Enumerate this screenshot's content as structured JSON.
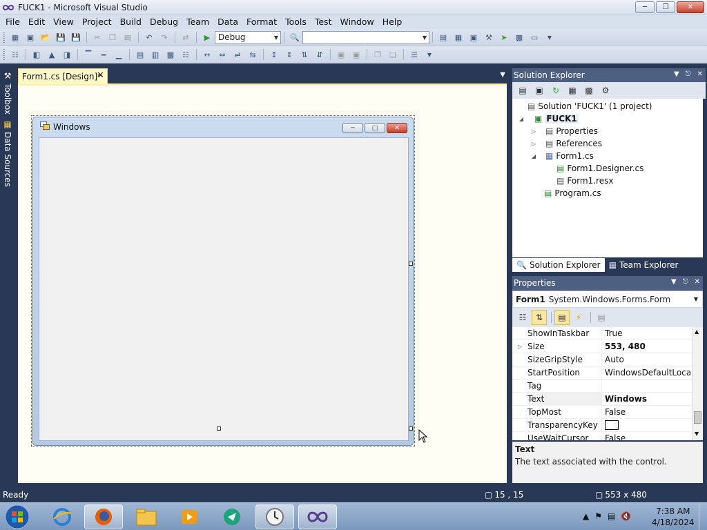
{
  "window": {
    "title": "FUCK1 - Microsoft Visual Studio"
  },
  "menu": [
    "File",
    "Edit",
    "View",
    "Project",
    "Build",
    "Debug",
    "Team",
    "Data",
    "Format",
    "Tools",
    "Test",
    "Window",
    "Help"
  ],
  "toolbar": {
    "config_value": "Debug",
    "platform_value": ""
  },
  "left_tabs": {
    "toolbox": "Toolbox",
    "data_sources": "Data Sources"
  },
  "doc_tab": {
    "label": "Form1.cs [Design]*"
  },
  "designer_form": {
    "title": "Windows"
  },
  "solution_explorer": {
    "header": "Solution Explorer",
    "tree": {
      "solution": "Solution 'FUCK1' (1 project)",
      "project": "FUCK1",
      "properties": "Properties",
      "references": "References",
      "form1": "Form1.cs",
      "form1_designer": "Form1.Designer.cs",
      "form1_resx": "Form1.resx",
      "program": "Program.cs"
    },
    "tabs": {
      "solution": "Solution Explorer",
      "team": "Team Explorer"
    }
  },
  "properties": {
    "header": "Properties",
    "object_name": "Form1",
    "object_type": "System.Windows.Forms.Form",
    "rows": [
      {
        "name": "ShowInTaskbar",
        "value": "True"
      },
      {
        "name": "Size",
        "value": "553, 480"
      },
      {
        "name": "SizeGripStyle",
        "value": "Auto"
      },
      {
        "name": "StartPosition",
        "value": "WindowsDefaultLocation"
      },
      {
        "name": "Tag",
        "value": ""
      },
      {
        "name": "Text",
        "value": "Windows"
      },
      {
        "name": "TopMost",
        "value": "False"
      },
      {
        "name": "TransparencyKey",
        "value": ""
      },
      {
        "name": "UseWaitCursor",
        "value": "False"
      }
    ],
    "description_title": "Text",
    "description_text": "The text associated with the control."
  },
  "status": {
    "text": "Ready",
    "position": "15 , 15",
    "size": "553 x 480"
  },
  "taskbar": {
    "time": "7:38 AM",
    "date": "4/18/2024"
  },
  "colors": {
    "ide_frame": "#293955",
    "doc_tab": "#fff8c8",
    "accent_header": "#4d6082"
  }
}
